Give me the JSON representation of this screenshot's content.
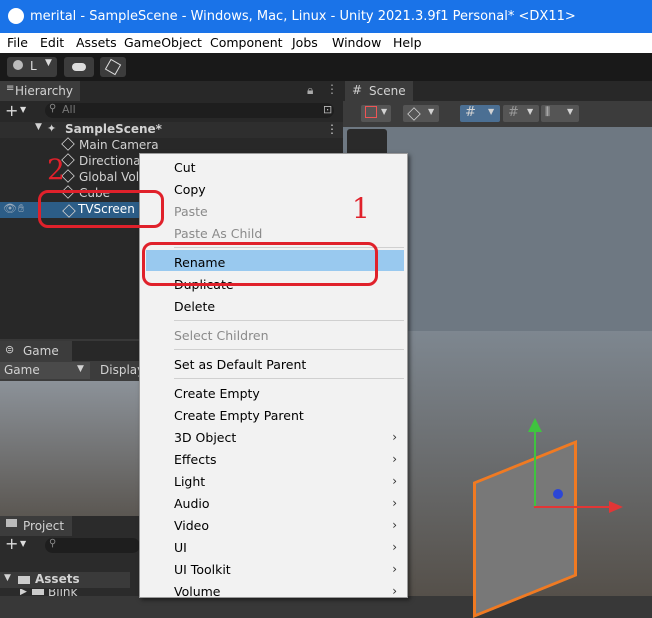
{
  "window": {
    "title": "merital - SampleScene - Windows, Mac, Linux - Unity 2021.3.9f1 Personal* <DX11>"
  },
  "menubar": [
    "File",
    "Edit",
    "Assets",
    "GameObject",
    "Component",
    "Jobs",
    "Window",
    "Help"
  ],
  "toolbar": {
    "account_label": "L"
  },
  "hierarchy": {
    "tab_label": "Hierarchy",
    "search_placeholder": "All",
    "scene_name": "SampleScene*",
    "items": [
      "Main Camera",
      "Directional",
      "Global Volu",
      "Cube",
      "TVScreen"
    ]
  },
  "scene_panel": {
    "tab_label": "Scene"
  },
  "game_panel": {
    "tab_label": "Game",
    "display_select": "Game",
    "display_label": "Display"
  },
  "project_panel": {
    "tab_label": "Project",
    "folder": "Assets",
    "subfolder": "Blink"
  },
  "context_menu": {
    "items": [
      {
        "label": "Cut",
        "disabled": false
      },
      {
        "label": "Copy",
        "disabled": false
      },
      {
        "label": "Paste",
        "disabled": true
      },
      {
        "label": "Paste As Child",
        "disabled": true
      },
      {
        "label": "Rename",
        "disabled": false,
        "highlighted": true
      },
      {
        "label": "Duplicate",
        "disabled": false
      },
      {
        "label": "Delete",
        "disabled": false
      },
      {
        "label": "Select Children",
        "disabled": true
      },
      {
        "label": "Set as Default Parent",
        "disabled": false
      },
      {
        "label": "Create Empty",
        "disabled": false
      },
      {
        "label": "Create Empty Parent",
        "disabled": false
      },
      {
        "label": "3D Object",
        "submenu": true
      },
      {
        "label": "Effects",
        "submenu": true
      },
      {
        "label": "Light",
        "submenu": true
      },
      {
        "label": "Audio",
        "submenu": true
      },
      {
        "label": "Video",
        "submenu": true
      },
      {
        "label": "UI",
        "submenu": true
      },
      {
        "label": "UI Toolkit",
        "submenu": true
      },
      {
        "label": "Volume",
        "submenu": true
      }
    ]
  },
  "annotations": {
    "one": "1",
    "two": "2"
  },
  "colors": {
    "highlight": "#99c9ef",
    "annotation": "#e0212b",
    "title_bar": "#1a73e8"
  }
}
